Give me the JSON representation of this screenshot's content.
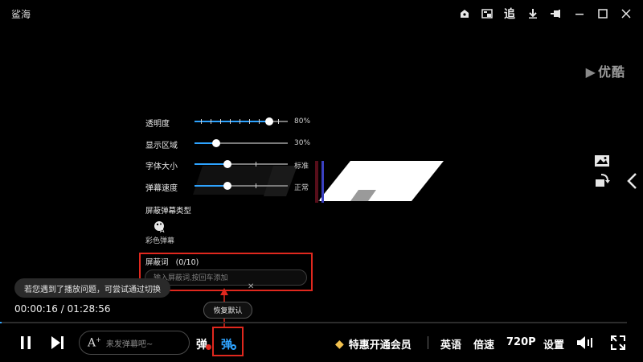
{
  "app": {
    "title": "鲨海"
  },
  "title_bar": {
    "icons": [
      "home-icon",
      "picture-in-picture-icon",
      "follow-icon",
      "download-icon",
      "pin-icon",
      "minimize-icon",
      "maximize-icon",
      "close-icon"
    ],
    "follow_label": "追"
  },
  "watermark": {
    "text": "优酷"
  },
  "danmaku_settings": {
    "opacity": {
      "label": "透明度",
      "value_text": "80%",
      "level": 0.8
    },
    "display_area": {
      "label": "显示区域",
      "value_text": "30%",
      "level": 0.3
    },
    "font_size": {
      "label": "字体大小",
      "value_text": "标准",
      "level": 0.33
    },
    "speed": {
      "label": "弹幕速度",
      "value_text": "正常",
      "level": 0.33
    },
    "block_type": {
      "label": "屏蔽弹幕类型",
      "option_label": "彩色弹幕"
    },
    "block_words": {
      "label": "屏蔽词",
      "count": "(0/10)",
      "placeholder": "输入屏蔽词,按回车添加"
    },
    "restore_label": "恢复默认"
  },
  "hint": {
    "text": "若您遇到了播放问题，可尝试通过切换",
    "close": "✕"
  },
  "playback": {
    "current": "00:00:16",
    "total": "01:28:56",
    "time_text": "00:00:16 / 01:28:56",
    "progress": 0.003
  },
  "controls": {
    "danmu_placeholder": "来发弹幕吧~",
    "danmu_label": "弹",
    "danmu_settings_label": "弹",
    "vip_label": "特惠开通会员",
    "language_label": "英语",
    "speed_label": "倍速",
    "quality_label": "720P",
    "settings_label": "设置"
  },
  "colors": {
    "accent": "#2ea3ff",
    "highlight": "#e0281e",
    "vip": "#f2c14e"
  }
}
